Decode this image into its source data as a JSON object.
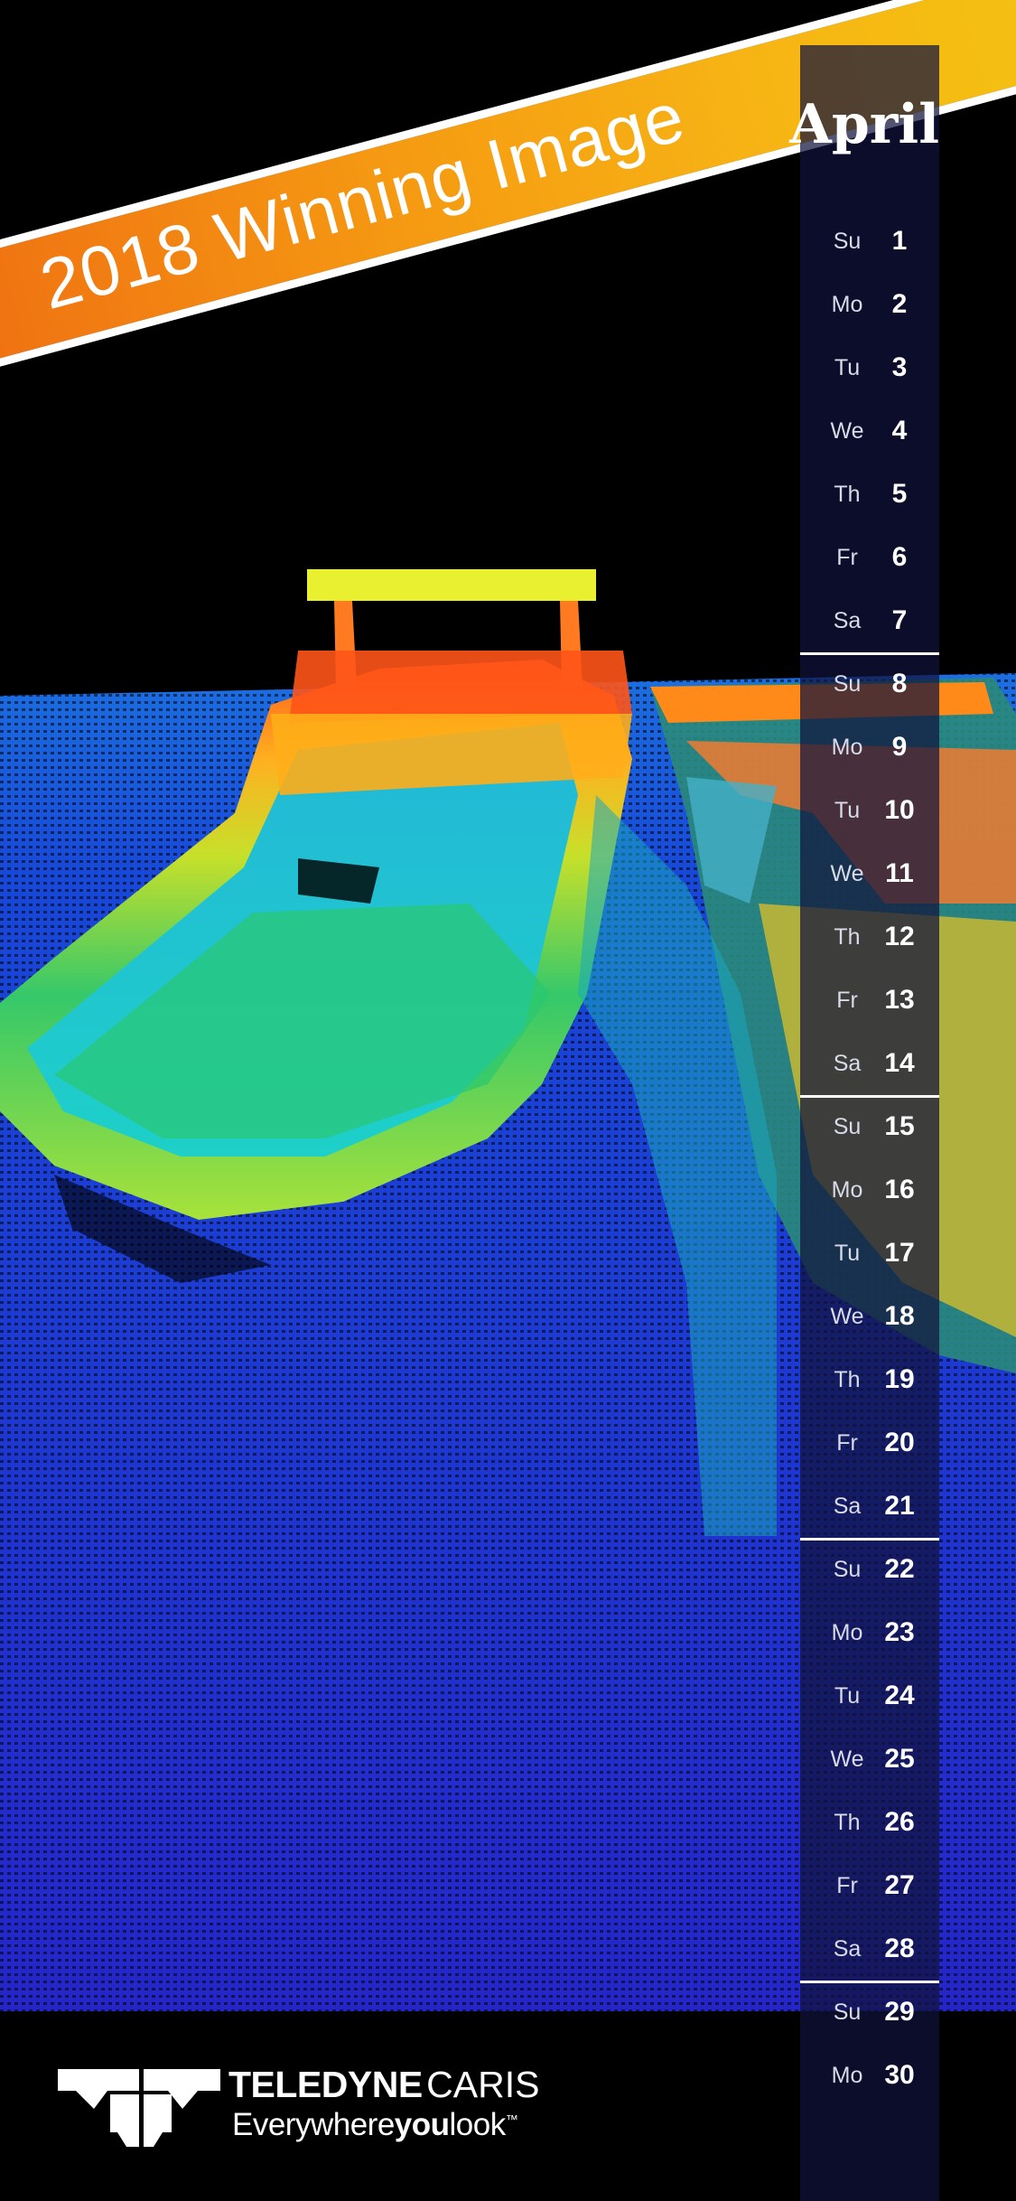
{
  "banner": {
    "text": "2018 Winning Image"
  },
  "calendar": {
    "month": "April",
    "days": [
      {
        "dow": "Su",
        "day": "1"
      },
      {
        "dow": "Mo",
        "day": "2"
      },
      {
        "dow": "Tu",
        "day": "3"
      },
      {
        "dow": "We",
        "day": "4"
      },
      {
        "dow": "Th",
        "day": "5"
      },
      {
        "dow": "Fr",
        "day": "6"
      },
      {
        "dow": "Sa",
        "day": "7"
      },
      {
        "dow": "Su",
        "day": "8"
      },
      {
        "dow": "Mo",
        "day": "9"
      },
      {
        "dow": "Tu",
        "day": "10"
      },
      {
        "dow": "We",
        "day": "11"
      },
      {
        "dow": "Th",
        "day": "12"
      },
      {
        "dow": "Fr",
        "day": "13"
      },
      {
        "dow": "Sa",
        "day": "14"
      },
      {
        "dow": "Su",
        "day": "15"
      },
      {
        "dow": "Mo",
        "day": "16"
      },
      {
        "dow": "Tu",
        "day": "17"
      },
      {
        "dow": "We",
        "day": "18"
      },
      {
        "dow": "Th",
        "day": "19"
      },
      {
        "dow": "Fr",
        "day": "20"
      },
      {
        "dow": "Sa",
        "day": "21"
      },
      {
        "dow": "Su",
        "day": "22"
      },
      {
        "dow": "Mo",
        "day": "23"
      },
      {
        "dow": "Tu",
        "day": "24"
      },
      {
        "dow": "We",
        "day": "25"
      },
      {
        "dow": "Th",
        "day": "26"
      },
      {
        "dow": "Fr",
        "day": "27"
      },
      {
        "dow": "Sa",
        "day": "28"
      },
      {
        "dow": "Su",
        "day": "29"
      },
      {
        "dow": "Mo",
        "day": "30"
      }
    ]
  },
  "brand": {
    "name_bold": "TELEDYNE",
    "name_regular": "CARIS",
    "tagline_start": "Everywhere",
    "tagline_bold": "you",
    "tagline_end": "look",
    "trademark": "™",
    "logo_icon": "teledyne-logo-icon"
  },
  "colors": {
    "banner_orange": "#f39c12",
    "seafloor_blue": "#2233cc",
    "calendar_panel": "#10123c"
  }
}
